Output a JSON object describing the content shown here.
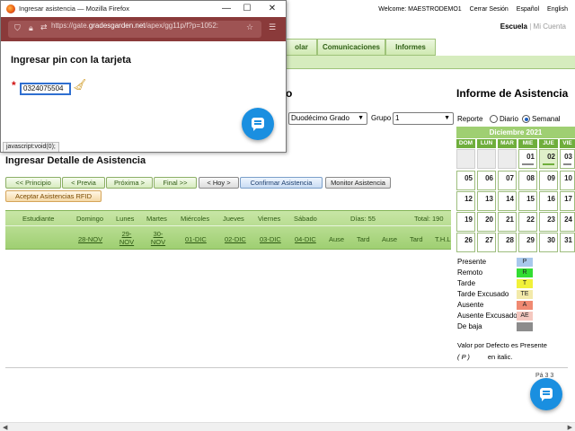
{
  "header": {
    "welcome": "Welcome: MAESTRODEMO1",
    "logout": "Cerrar Sesión",
    "lang_es": "Español",
    "lang_en": "English",
    "escuela": "Escuela",
    "separator": "|",
    "mi_cuenta": "Mi Cuenta"
  },
  "nav": {
    "tabs": [
      {
        "label": "olar"
      },
      {
        "label": "Comunicaciones"
      },
      {
        "label": "Informes"
      }
    ]
  },
  "page": {
    "title_partial": "o",
    "detalle_title": "Ingresar Detalle de Asistencia",
    "informe_title": "Informe de Asistencia"
  },
  "filters": {
    "grade_value": "Duodécimo Grado",
    "group_label": "Grupo",
    "group_value": "1",
    "report_label": "Reporte",
    "daily_label": "Diario",
    "weekly_label": "Semanal"
  },
  "buttons": {
    "principio": "<< Principio",
    "previa": "< Previa",
    "proxima": "Próxima >",
    "final": "Final >>",
    "hoy": "< Hoy >",
    "confirmar": "Confirmar Asistencia",
    "monitor": "Monitor Asistencia",
    "rfid": "Aceptar Asistencias RFID"
  },
  "attendance": {
    "headers": {
      "student": "Estudiante",
      "domingo": "Domingo",
      "lunes": "Lunes",
      "martes": "Martes",
      "miercoles": "Miércoles",
      "jueves": "Jueves",
      "viernes": "Viernes",
      "sabado": "Sábado",
      "dias": "Días: 55",
      "total": "Total: 190"
    },
    "dates": {
      "d1": "28-NOV",
      "d2a": "29-",
      "d2b": "NOV",
      "d3a": "30-",
      "d3b": "NOV",
      "d4": "01-DIC",
      "d5": "02-DIC",
      "d6": "03-DIC",
      "d7": "04-DIC"
    },
    "summary": {
      "c1": "Ause",
      "c2": "Tard",
      "c3": "Ause",
      "c4": "Tard",
      "c5": "T.H.L"
    }
  },
  "calendar": {
    "month": "Diciembre 2021",
    "weekdays": [
      "DOM",
      "LUN",
      "MAR",
      "MIE",
      "JUE",
      "VIE"
    ],
    "weeks": [
      [
        "",
        "",
        "",
        "01",
        "02",
        "03"
      ],
      [
        "05",
        "06",
        "07",
        "08",
        "09",
        "10"
      ],
      [
        "12",
        "13",
        "14",
        "15",
        "16",
        "17"
      ],
      [
        "19",
        "20",
        "21",
        "22",
        "23",
        "24"
      ],
      [
        "26",
        "27",
        "28",
        "29",
        "30",
        "31"
      ]
    ]
  },
  "legend": {
    "items": [
      {
        "label": "Presente",
        "code": "P",
        "color": "#a8c8ec"
      },
      {
        "label": "Remoto",
        "code": "R",
        "color": "#33dd33"
      },
      {
        "label": "Tarde",
        "code": "T",
        "color": "#f1f13a"
      },
      {
        "label": "Tarde Excusado",
        "code": "TE",
        "color": "#f3eaaa"
      },
      {
        "label": "Ausente",
        "code": "A",
        "color": "#f08a72"
      },
      {
        "label": "Ausente Excusado",
        "code": "AE",
        "color": "#f5c8c0"
      },
      {
        "label": "De baja",
        "code": "",
        "color": "#8c8c8c"
      }
    ],
    "note_line1": "Valor por Defecto es Presente",
    "note_code": "( P )",
    "note_italic": "en italic."
  },
  "footer": {
    "page_label": "Pá     3 3"
  },
  "popup": {
    "window_title": "Ingresar asistencia — Mozilla Firefox",
    "url_prefix": "https://gate.",
    "url_domain": "gradesgarden.net",
    "url_suffix": "/apex/gg11p/f?p=1052:",
    "heading": "Ingresar pin con la tarjeta",
    "asterisk": "*",
    "pin_value": "0324075504",
    "status": "javascript:void(0);"
  }
}
